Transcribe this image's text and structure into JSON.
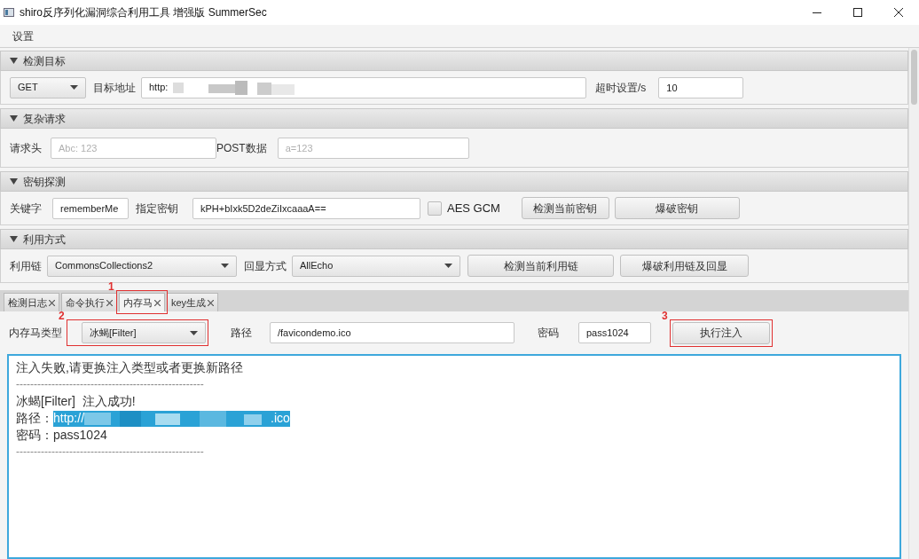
{
  "window": {
    "title": "shiro反序列化漏洞综合利用工具 增强版 SummerSec"
  },
  "menu": [
    "设置"
  ],
  "sections": [
    {
      "title": "检测目标",
      "expanded": true,
      "kind": "target",
      "method": "GET",
      "url_label": "目标地址",
      "url": "http:",
      "url_redacted": true,
      "timeout_label": "超时设置/s",
      "timeout": "10"
    },
    {
      "title": "复杂请求",
      "expanded": true,
      "kind": "request",
      "headers_label": "请求头",
      "headers_placeholder": "Abc: 123",
      "post_label": "POST数据",
      "post_placeholder": "a=123"
    },
    {
      "title": "密钥探测",
      "expanded": true,
      "kind": "key",
      "keyword_label": "关键字",
      "keyword": "rememberMe",
      "key_label": "指定密钥",
      "key": "kPH+bIxk5D2deZiIxcaaaA==",
      "gcm_label": "AES GCM",
      "gcm_checked": false,
      "buttons": [
        "检测当前密钥",
        "爆破密钥"
      ]
    },
    {
      "title": "利用方式",
      "expanded": true,
      "kind": "exploit",
      "chain_label": "利用链",
      "chain": "CommonsCollections2",
      "echo_label": "回显方式",
      "echo": "AllEcho",
      "buttons": [
        "检测当前利用链",
        "爆破利用链及回显"
      ]
    }
  ],
  "tabs": [
    {
      "label": "检测日志",
      "selected": false
    },
    {
      "label": "命令执行",
      "selected": false
    },
    {
      "label": "内存马",
      "selected": true,
      "annotation": "1"
    },
    {
      "label": "key生成",
      "selected": false
    }
  ],
  "shell_form": {
    "type_label": "内存马类型",
    "type": "冰蝎[Filter]",
    "type_annotation": "2",
    "path_label": "路径",
    "path": "/favicondemo.ico",
    "password_label": "密码",
    "password": "pass1024",
    "button": "执行注入",
    "button_annotation": "3"
  },
  "output": [
    {
      "kind": "text",
      "text": "注入失败,请更换注入类型或者更换新路径"
    },
    {
      "kind": "rule",
      "text": "-----------------------------------------------------"
    },
    {
      "kind": "text",
      "text": "冰蝎[Filter]  注入成功!"
    },
    {
      "kind": "link",
      "label": "路径：",
      "head": "http://",
      "tail": ".ico"
    },
    {
      "kind": "text",
      "text": "密码：pass1024"
    },
    {
      "kind": "rule",
      "text": "-----------------------------------------------------"
    }
  ]
}
